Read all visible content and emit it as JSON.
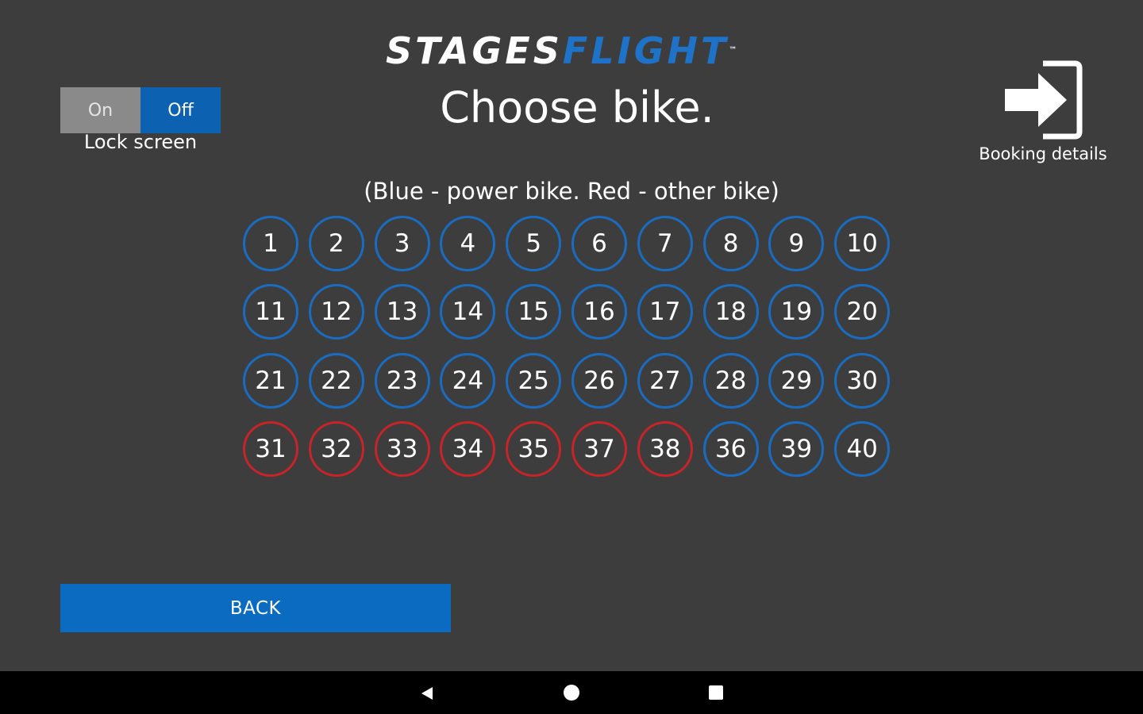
{
  "header": {
    "logo_part1": "STAGES",
    "logo_part2": "FLIGHT",
    "logo_tm": "™",
    "title": "Choose bike."
  },
  "lock_screen": {
    "on_label": "On",
    "off_label": "Off",
    "selected": "Off",
    "label": "Lock screen"
  },
  "booking": {
    "icon": "sign-in-arrow-icon",
    "label": "Booking details"
  },
  "legend": "(Blue - power bike. Red - other bike)",
  "colors": {
    "background": "#3d3d3d",
    "power_bike": "#1a6cc0",
    "other_bike": "#c62428",
    "accent": "#0a6bc0",
    "logo_blue": "#1e73c8"
  },
  "bikes": [
    [
      "1",
      "power"
    ],
    [
      "2",
      "power"
    ],
    [
      "3",
      "power"
    ],
    [
      "4",
      "power"
    ],
    [
      "5",
      "power"
    ],
    [
      "6",
      "power"
    ],
    [
      "7",
      "power"
    ],
    [
      "8",
      "power"
    ],
    [
      "9",
      "power"
    ],
    [
      "10",
      "power"
    ],
    [
      "11",
      "power"
    ],
    [
      "12",
      "power"
    ],
    [
      "13",
      "power"
    ],
    [
      "14",
      "power"
    ],
    [
      "15",
      "power"
    ],
    [
      "16",
      "power"
    ],
    [
      "17",
      "power"
    ],
    [
      "18",
      "power"
    ],
    [
      "19",
      "power"
    ],
    [
      "20",
      "power"
    ],
    [
      "21",
      "power"
    ],
    [
      "22",
      "power"
    ],
    [
      "23",
      "power"
    ],
    [
      "24",
      "power"
    ],
    [
      "25",
      "power"
    ],
    [
      "26",
      "power"
    ],
    [
      "27",
      "power"
    ],
    [
      "28",
      "power"
    ],
    [
      "29",
      "power"
    ],
    [
      "30",
      "power"
    ],
    [
      "31",
      "other"
    ],
    [
      "32",
      "other"
    ],
    [
      "33",
      "other"
    ],
    [
      "34",
      "other"
    ],
    [
      "35",
      "other"
    ],
    [
      "37",
      "other"
    ],
    [
      "38",
      "other"
    ],
    [
      "36",
      "power"
    ],
    [
      "39",
      "power"
    ],
    [
      "40",
      "power"
    ]
  ],
  "back_button": {
    "label": "BACK"
  },
  "navbar": {
    "back_icon": "triangle-back-icon",
    "home_icon": "circle-home-icon",
    "recent_icon": "square-recents-icon"
  }
}
